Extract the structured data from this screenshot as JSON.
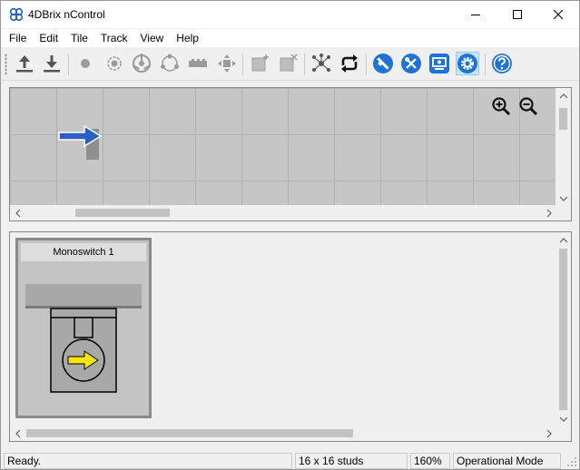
{
  "window": {
    "title": "4DBrix nControl",
    "app_icon": "4dbrix-logo-icon",
    "controls": [
      "minimize-icon",
      "maximize-icon",
      "close-icon"
    ]
  },
  "menu": {
    "items": [
      {
        "label": "File"
      },
      {
        "label": "Edit"
      },
      {
        "label": "Tile"
      },
      {
        "label": "Track"
      },
      {
        "label": "View"
      },
      {
        "label": "Help"
      }
    ]
  },
  "toolbar": {
    "buttons": [
      {
        "icon": "upload-icon",
        "enabled": true
      },
      {
        "icon": "download-icon",
        "enabled": true
      },
      {
        "icon": "dot-icon",
        "enabled": false
      },
      {
        "icon": "target-icon",
        "enabled": false
      },
      {
        "icon": "turntable-icon",
        "enabled": false
      },
      {
        "icon": "circle-nodes-icon",
        "enabled": false
      },
      {
        "icon": "track-piece-icon",
        "enabled": false
      },
      {
        "icon": "move-arrows-icon",
        "enabled": false
      },
      {
        "icon": "add-tile-icon",
        "enabled": false
      },
      {
        "icon": "delete-tile-icon",
        "enabled": false
      },
      {
        "icon": "network-icon",
        "enabled": true
      },
      {
        "icon": "loop-arrows-icon",
        "enabled": true
      },
      {
        "icon": "edit-tools-icon",
        "enabled": true
      },
      {
        "icon": "wrench-screwdriver-icon",
        "enabled": true
      },
      {
        "icon": "monitor-icon",
        "enabled": true
      },
      {
        "icon": "gear-icon",
        "enabled": true,
        "pressed": true
      },
      {
        "icon": "help-icon",
        "enabled": true
      }
    ]
  },
  "map": {
    "zoom_in_icon": "zoom-in-icon",
    "zoom_out_icon": "zoom-out-icon",
    "tile_icon": "switch-arrow-icon"
  },
  "tiles": {
    "items": [
      {
        "label": "Monoswitch 1",
        "icon": "monoswitch-icon"
      }
    ]
  },
  "status": {
    "message": "Ready.",
    "grid_size": "16 x 16 studs",
    "zoom": "160%",
    "mode": "Operational Mode"
  },
  "colors": {
    "accent_blue": "#1e74d6",
    "map_background": "#c6c6c6",
    "switch_arrow": "#2a5fc4",
    "tile_arrow": "#f5e50f"
  }
}
